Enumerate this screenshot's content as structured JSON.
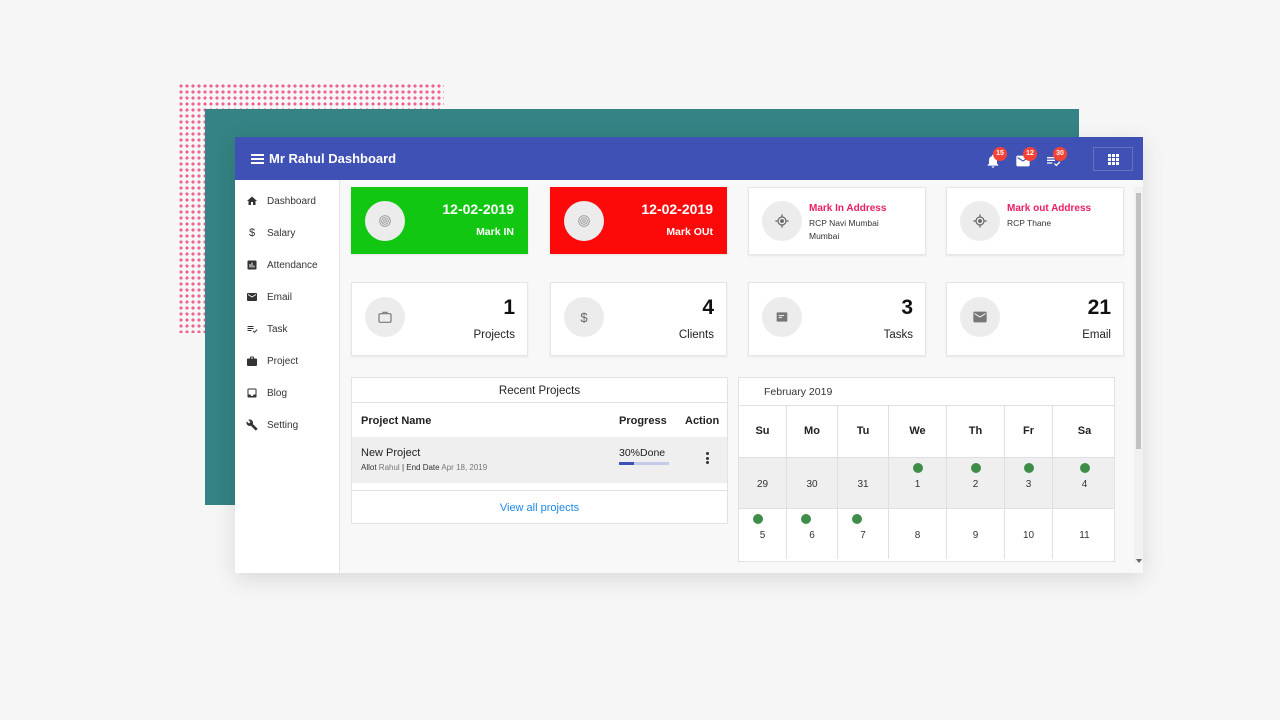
{
  "app": {
    "title": "Mr Rahul Dashboard"
  },
  "topbar": {
    "notifications": {
      "icon": "bell-icon",
      "count": "15"
    },
    "mail": {
      "icon": "mail-icon",
      "count": "12"
    },
    "tasks": {
      "icon": "checklist-icon",
      "count": "30"
    },
    "apps_icon": "apps-grid-icon"
  },
  "sidebar": {
    "items": [
      {
        "label": "Dashboard",
        "icon": "home-icon"
      },
      {
        "label": "Salary",
        "icon": "dollar-icon"
      },
      {
        "label": "Attendance",
        "icon": "chart-icon"
      },
      {
        "label": "Email",
        "icon": "mail-icon"
      },
      {
        "label": "Task",
        "icon": "checklist-icon"
      },
      {
        "label": "Project",
        "icon": "briefcase-icon"
      },
      {
        "label": "Blog",
        "icon": "inbox-icon"
      },
      {
        "label": "Setting",
        "icon": "wrench-icon"
      }
    ]
  },
  "attendance": {
    "mark_in": {
      "date": "12-02-2019",
      "label": "Mark IN",
      "color": "#11c711"
    },
    "mark_out": {
      "date": "12-02-2019",
      "label": "Mark OUt",
      "color": "#fc0a0a"
    },
    "in_address": {
      "title": "Mark In Address",
      "text": "RCP Navi Mumbai Mumbai"
    },
    "out_address": {
      "title": "Mark out Address",
      "text": "RCP Thane"
    }
  },
  "stats": [
    {
      "value": "1",
      "label": "Projects",
      "icon": "briefcase-icon"
    },
    {
      "value": "4",
      "label": "Clients",
      "icon": "dollar-icon"
    },
    {
      "value": "3",
      "label": "Tasks",
      "icon": "folder-icon"
    },
    {
      "value": "21",
      "label": "Email",
      "icon": "mail-icon"
    }
  ],
  "recent_projects": {
    "title": "Recent Projects",
    "columns": {
      "name": "Project Name",
      "progress": "Progress",
      "action": "Action"
    },
    "rows": [
      {
        "name": "New Project",
        "allot_label": "Allot",
        "allot_value": "Rahul",
        "separator": "|",
        "end_label": "End Date",
        "end_value": "Apr 18, 2019",
        "progress_text": "30%Done",
        "progress": 0.3
      }
    ],
    "view_all": "View all projects"
  },
  "calendar": {
    "month": "February 2019",
    "weekdays": [
      "Su",
      "Mo",
      "Tu",
      "We",
      "Th",
      "Fr",
      "Sa"
    ],
    "weeks": [
      [
        {
          "day": "29",
          "dot": false
        },
        {
          "day": "30",
          "dot": false
        },
        {
          "day": "31",
          "dot": false
        },
        {
          "day": "1",
          "dot": true
        },
        {
          "day": "2",
          "dot": true
        },
        {
          "day": "3",
          "dot": true
        },
        {
          "day": "4",
          "dot": true
        }
      ],
      [
        {
          "day": "5",
          "dot": true
        },
        {
          "day": "6",
          "dot": true
        },
        {
          "day": "7",
          "dot": true
        },
        {
          "day": "8",
          "dot": false
        },
        {
          "day": "9",
          "dot": false
        },
        {
          "day": "10",
          "dot": false
        },
        {
          "day": "11",
          "dot": false
        }
      ]
    ],
    "event_color": "#3e8e49"
  },
  "colors": {
    "primary": "#3f51b5",
    "accent": "#e91e63",
    "link": "#1e88e5"
  }
}
